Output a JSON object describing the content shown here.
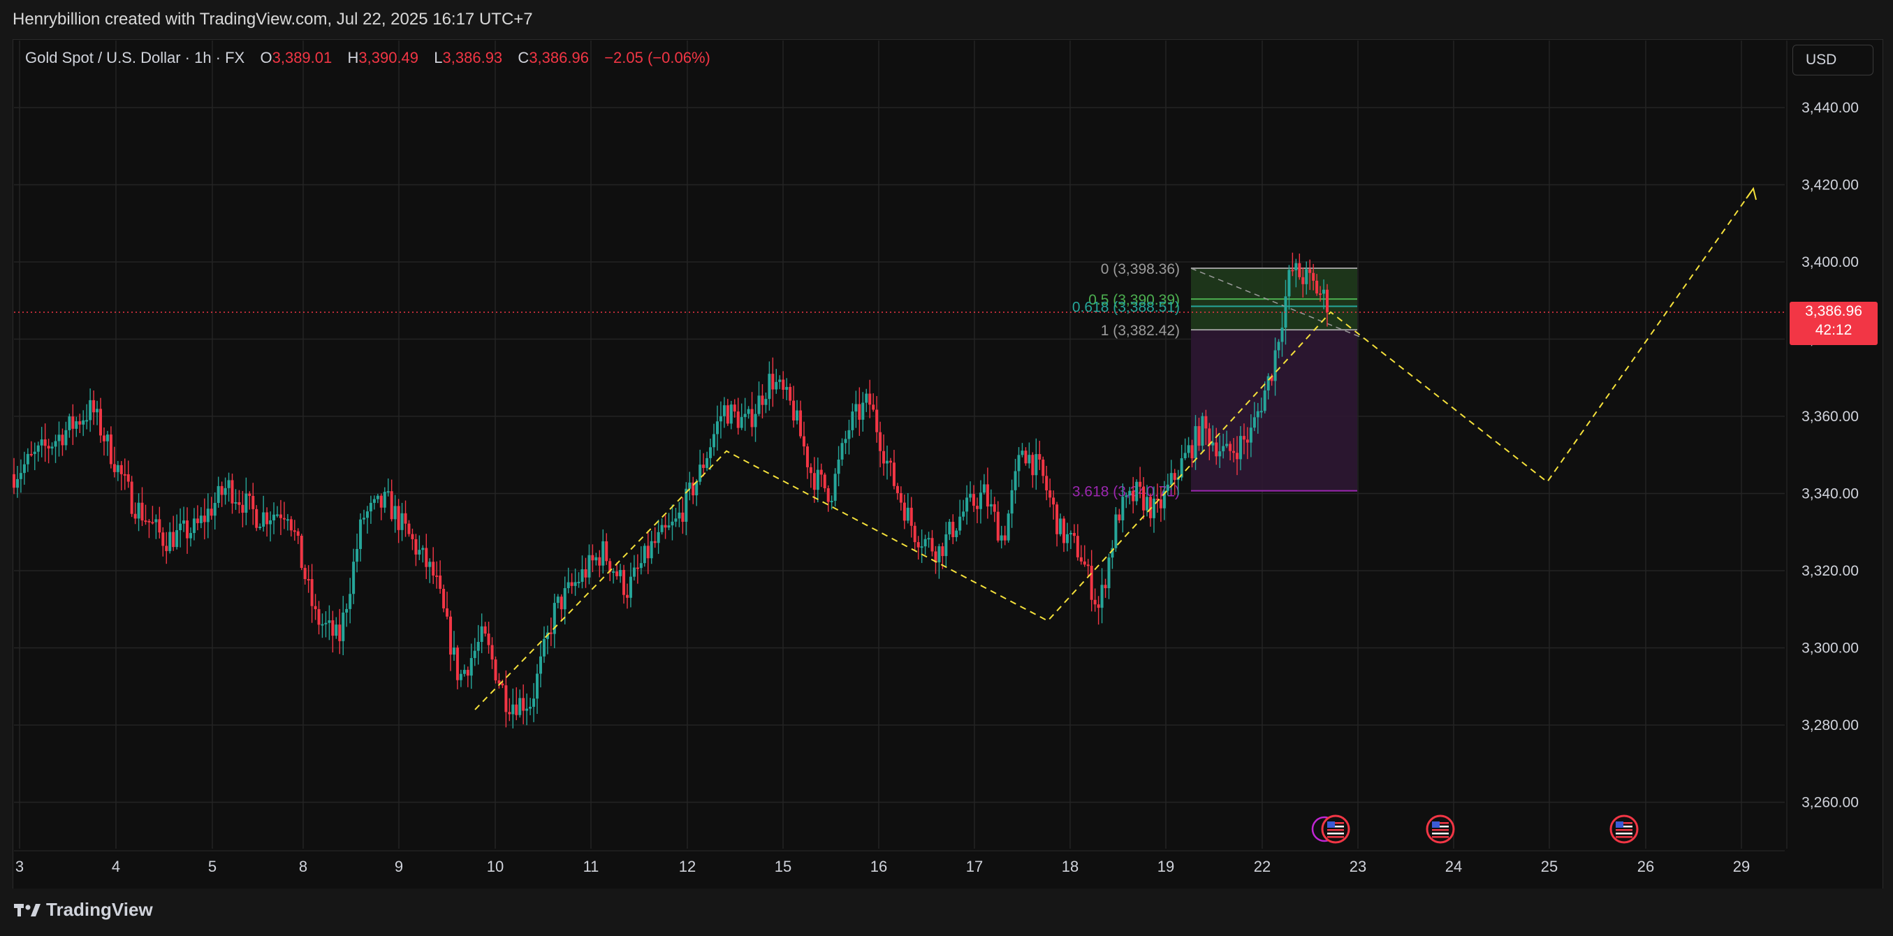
{
  "header": {
    "attribution": "Henrybillion created with TradingView.com, Jul 22, 2025 16:17 UTC+7"
  },
  "legend": {
    "symbol": "Gold Spot / U.S. Dollar · 1h · FX",
    "o_label": "O",
    "o_value": "3,389.01",
    "h_label": "H",
    "h_value": "3,390.49",
    "l_label": "L",
    "l_value": "3,386.93",
    "c_label": "C",
    "c_value": "3,386.96",
    "change": "−2.05 (−0.06%)"
  },
  "currency_button": "USD",
  "last_price": {
    "price": "3,386.96",
    "countdown": "42:12"
  },
  "footer": {
    "brand": "TradingView"
  },
  "colors": {
    "up": "#26a69a",
    "down": "#f23645",
    "projection": "#f5e13b",
    "fib_zone_green": "#1f3a1c",
    "fib_zone_purple": "#2d1733",
    "fib_0": "#9b9b9b",
    "fib_05": "#4caf50",
    "fib_0618": "#26a69a",
    "fib_1": "#9b9b9b",
    "fib_3618": "#9c27b0"
  },
  "chart_data": {
    "type": "candlestick",
    "timeframe": "1h",
    "y_axis": {
      "min": 3250,
      "max": 3450,
      "ticks": [
        "3,260.00",
        "3,280.00",
        "3,300.00",
        "3,320.00",
        "3,340.00",
        "3,360.00",
        "3,380.00",
        "3,400.00",
        "3,420.00",
        "3,440.00"
      ]
    },
    "x_axis": {
      "ticks": [
        "3",
        "4",
        "5",
        "8",
        "9",
        "10",
        "11",
        "12",
        "15",
        "16",
        "17",
        "18",
        "19",
        "22",
        "23",
        "24",
        "25",
        "26",
        "29"
      ]
    },
    "ohlc_path": [
      {
        "x": "3",
        "price": 3345
      },
      {
        "x": "3",
        "price": 3362
      },
      {
        "x": "4",
        "price": 3338
      },
      {
        "x": "4",
        "price": 3328
      },
      {
        "x": "4",
        "price": 3331
      },
      {
        "x": "5",
        "price": 3342
      },
      {
        "x": "5",
        "price": 3334
      },
      {
        "x": "5",
        "price": 3336
      },
      {
        "x": "8",
        "price": 3308
      },
      {
        "x": "8",
        "price": 3302
      },
      {
        "x": "8",
        "price": 3334
      },
      {
        "x": "8",
        "price": 3338
      },
      {
        "x": "9",
        "price": 3328
      },
      {
        "x": "9",
        "price": 3318
      },
      {
        "x": "9",
        "price": 3292
      },
      {
        "x": "9",
        "price": 3303
      },
      {
        "x": "10",
        "price": 3286
      },
      {
        "x": "10",
        "price": 3286
      },
      {
        "x": "10",
        "price": 3310
      },
      {
        "x": "10",
        "price": 3318
      },
      {
        "x": "11",
        "price": 3325
      },
      {
        "x": "11",
        "price": 3315
      },
      {
        "x": "11",
        "price": 3326
      },
      {
        "x": "11",
        "price": 3332
      },
      {
        "x": "12",
        "price": 3345
      },
      {
        "x": "12",
        "price": 3362
      },
      {
        "x": "12",
        "price": 3358
      },
      {
        "x": "12",
        "price": 3370
      },
      {
        "x": "15",
        "price": 3362
      },
      {
        "x": "15",
        "price": 3345
      },
      {
        "x": "15",
        "price": 3340
      },
      {
        "x": "15",
        "price": 3358
      },
      {
        "x": "15",
        "price": 3364
      },
      {
        "x": "16",
        "price": 3345
      },
      {
        "x": "16",
        "price": 3330
      },
      {
        "x": "16",
        "price": 3325
      },
      {
        "x": "16",
        "price": 3335
      },
      {
        "x": "17",
        "price": 3340
      },
      {
        "x": "17",
        "price": 3328
      },
      {
        "x": "17",
        "price": 3352
      },
      {
        "x": "17",
        "price": 3345
      },
      {
        "x": "17",
        "price": 3330
      },
      {
        "x": "18",
        "price": 3325
      },
      {
        "x": "18",
        "price": 3310
      },
      {
        "x": "18",
        "price": 3335
      },
      {
        "x": "18",
        "price": 3340
      },
      {
        "x": "18",
        "price": 3335
      },
      {
        "x": "19",
        "price": 3346
      },
      {
        "x": "19",
        "price": 3357
      },
      {
        "x": "19",
        "price": 3350
      },
      {
        "x": "19",
        "price": 3355
      },
      {
        "x": "22",
        "price": 3372
      },
      {
        "x": "22",
        "price": 3398
      },
      {
        "x": "22",
        "price": 3395
      },
      {
        "x": "22",
        "price": 3389
      },
      {
        "x": "22",
        "price": 3386.96
      }
    ],
    "projection_path": [
      {
        "x": "9",
        "price": 3284
      },
      {
        "x": "12",
        "price": 3351
      },
      {
        "x": "17",
        "price": 3307
      },
      {
        "x": "22",
        "price": 3387
      },
      {
        "x": "24",
        "price": 3343
      },
      {
        "x": "29",
        "price": 3419
      }
    ],
    "fib_levels": [
      {
        "label": "0 (3,398.36)",
        "price": 3398.36
      },
      {
        "label": "0.5 (3,390.39)",
        "price": 3390.39
      },
      {
        "label": "0.618 (3,388.51)",
        "price": 3388.51
      },
      {
        "label": "1 (3,382.42)",
        "price": 3382.42
      },
      {
        "label": "3.618 (3,340.71)",
        "price": 3340.71
      }
    ],
    "last_price": 3386.96,
    "event_markers": 4
  }
}
